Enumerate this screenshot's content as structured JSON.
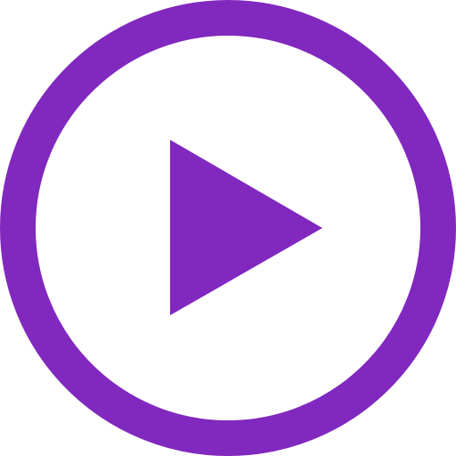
{
  "icon": {
    "name": "play-circle-icon",
    "accent_color": "#8128BF",
    "background_color": "#FFFFFF"
  }
}
